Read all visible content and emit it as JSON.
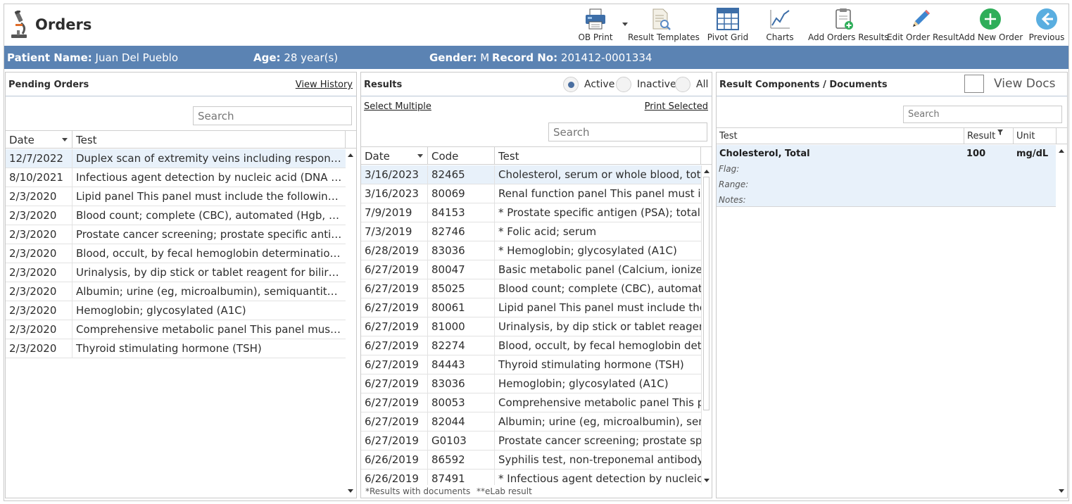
{
  "app": {
    "title": "Orders"
  },
  "toolbar": [
    {
      "key": "ob-print",
      "label": "OB Print",
      "icon": "printer-icon"
    },
    {
      "key": "result-templates",
      "label": "Result Templates",
      "icon": "document-search-icon"
    },
    {
      "key": "pivot-grid",
      "label": "Pivot Grid",
      "icon": "grid-icon"
    },
    {
      "key": "charts",
      "label": "Charts",
      "icon": "line-chart-icon"
    },
    {
      "key": "add-orders-results",
      "label": "Add Orders Results",
      "icon": "clipboard-add-icon"
    },
    {
      "key": "edit-order-result",
      "label": "Edit Order Result",
      "icon": "pencil-icon"
    },
    {
      "key": "add-new-order",
      "label": "Add New Order",
      "icon": "plus-circle-icon"
    },
    {
      "key": "previous",
      "label": "Previous",
      "icon": "back-arrow-icon"
    }
  ],
  "patient": {
    "name_label": "Patient Name:",
    "name": "Juan Del Pueblo",
    "age_label": "Age:",
    "age": "28 year(s)",
    "gender_label": "Gender:",
    "gender": "M",
    "record_label": "Record No:",
    "record": "201412-0001334"
  },
  "pending": {
    "title": "Pending Orders",
    "history_link": "View History",
    "search_placeholder": "Search",
    "columns": [
      "Date",
      "Test"
    ],
    "rows": [
      {
        "date": "12/7/2022",
        "test": "Duplex scan of extremity veins including responses to compression"
      },
      {
        "date": "8/10/2021",
        "test": "Infectious agent detection by nucleic acid (DNA or RNA)"
      },
      {
        "date": "2/3/2020",
        "test": "Lipid panel This panel must include the following: Cholesterol"
      },
      {
        "date": "2/3/2020",
        "test": "Blood count; complete (CBC), automated (Hgb, Hct, RBC, WBC)"
      },
      {
        "date": "2/3/2020",
        "test": "Prostate cancer screening; prostate specific antigen test (PSA)"
      },
      {
        "date": "2/3/2020",
        "test": "Blood, occult, by fecal hemoglobin determination by immunoassay"
      },
      {
        "date": "2/3/2020",
        "test": "Urinalysis, by dip stick or tablet reagent for bilirubin, glucose"
      },
      {
        "date": "2/3/2020",
        "test": "Albumin; urine (eg, microalbumin), semiquantitative (eg, reagent strip)"
      },
      {
        "date": "2/3/2020",
        "test": "Hemoglobin; glycosylated (A1C)"
      },
      {
        "date": "2/3/2020",
        "test": "Comprehensive metabolic panel This panel must include the following"
      },
      {
        "date": "2/3/2020",
        "test": "Thyroid stimulating hormone (TSH)"
      }
    ]
  },
  "results": {
    "title": "Results",
    "radios": [
      {
        "label": "Active",
        "checked": true
      },
      {
        "label": "Inactive",
        "checked": false
      },
      {
        "label": "All",
        "checked": false
      }
    ],
    "select_multiple": "Select Multiple",
    "print_selected": "Print Selected",
    "search_placeholder": "Search",
    "columns": [
      "Date",
      "Code",
      "Test"
    ],
    "rows": [
      {
        "date": "3/16/2023",
        "code": "82465",
        "test": "Cholesterol, serum or whole blood, total"
      },
      {
        "date": "3/16/2023",
        "code": "80069",
        "test": "Renal function panel This panel must include"
      },
      {
        "date": "7/9/2019",
        "code": "84153",
        "test": "* Prostate specific antigen (PSA); total"
      },
      {
        "date": "7/3/2019",
        "code": "82746",
        "test": "* Folic acid; serum"
      },
      {
        "date": "6/28/2019",
        "code": "83036",
        "test": "* Hemoglobin; glycosylated (A1C)"
      },
      {
        "date": "6/27/2019",
        "code": "80047",
        "test": "Basic metabolic panel (Calcium, ionized) This"
      },
      {
        "date": "6/27/2019",
        "code": "85025",
        "test": "Blood count; complete (CBC), automated (Hgb"
      },
      {
        "date": "6/27/2019",
        "code": "80061",
        "test": "Lipid panel This panel must include the following"
      },
      {
        "date": "6/27/2019",
        "code": "81000",
        "test": "Urinalysis, by dip stick or tablet reagent for"
      },
      {
        "date": "6/27/2019",
        "code": "82274",
        "test": "Blood, occult, by fecal hemoglobin determination"
      },
      {
        "date": "6/27/2019",
        "code": "84443",
        "test": "Thyroid stimulating hormone (TSH)"
      },
      {
        "date": "6/27/2019",
        "code": "83036",
        "test": "Hemoglobin; glycosylated (A1C)"
      },
      {
        "date": "6/27/2019",
        "code": "80053",
        "test": "Comprehensive metabolic panel This panel must"
      },
      {
        "date": "6/27/2019",
        "code": "82044",
        "test": "Albumin; urine (eg, microalbumin), semiquantitative"
      },
      {
        "date": "6/27/2019",
        "code": "G0103",
        "test": "Prostate cancer screening; prostate specific antigen"
      },
      {
        "date": "6/26/2019",
        "code": "86592",
        "test": "Syphilis test, non-treponemal antibody; qualitative"
      },
      {
        "date": "6/26/2019",
        "code": "87491",
        "test": "* Infectious agent detection by nucleic acid"
      }
    ],
    "footnote_docs": "*Results with documents",
    "footnote_elab": "**eLab result"
  },
  "components": {
    "title": "Result Components / Documents",
    "view_docs": "View Docs",
    "search_placeholder": "Search",
    "columns": [
      "Test",
      "Result",
      "Unit"
    ],
    "row": {
      "test": "Cholesterol, Total",
      "result": "100",
      "unit": "mg/dL",
      "flag_label": "Flag:",
      "range_label": "Range:",
      "notes_label": "Notes:"
    }
  },
  "colors": {
    "patient_bar": "#5b83b3",
    "selected_row": "#e8f1fa",
    "radio_on": "#4a6ea0"
  }
}
